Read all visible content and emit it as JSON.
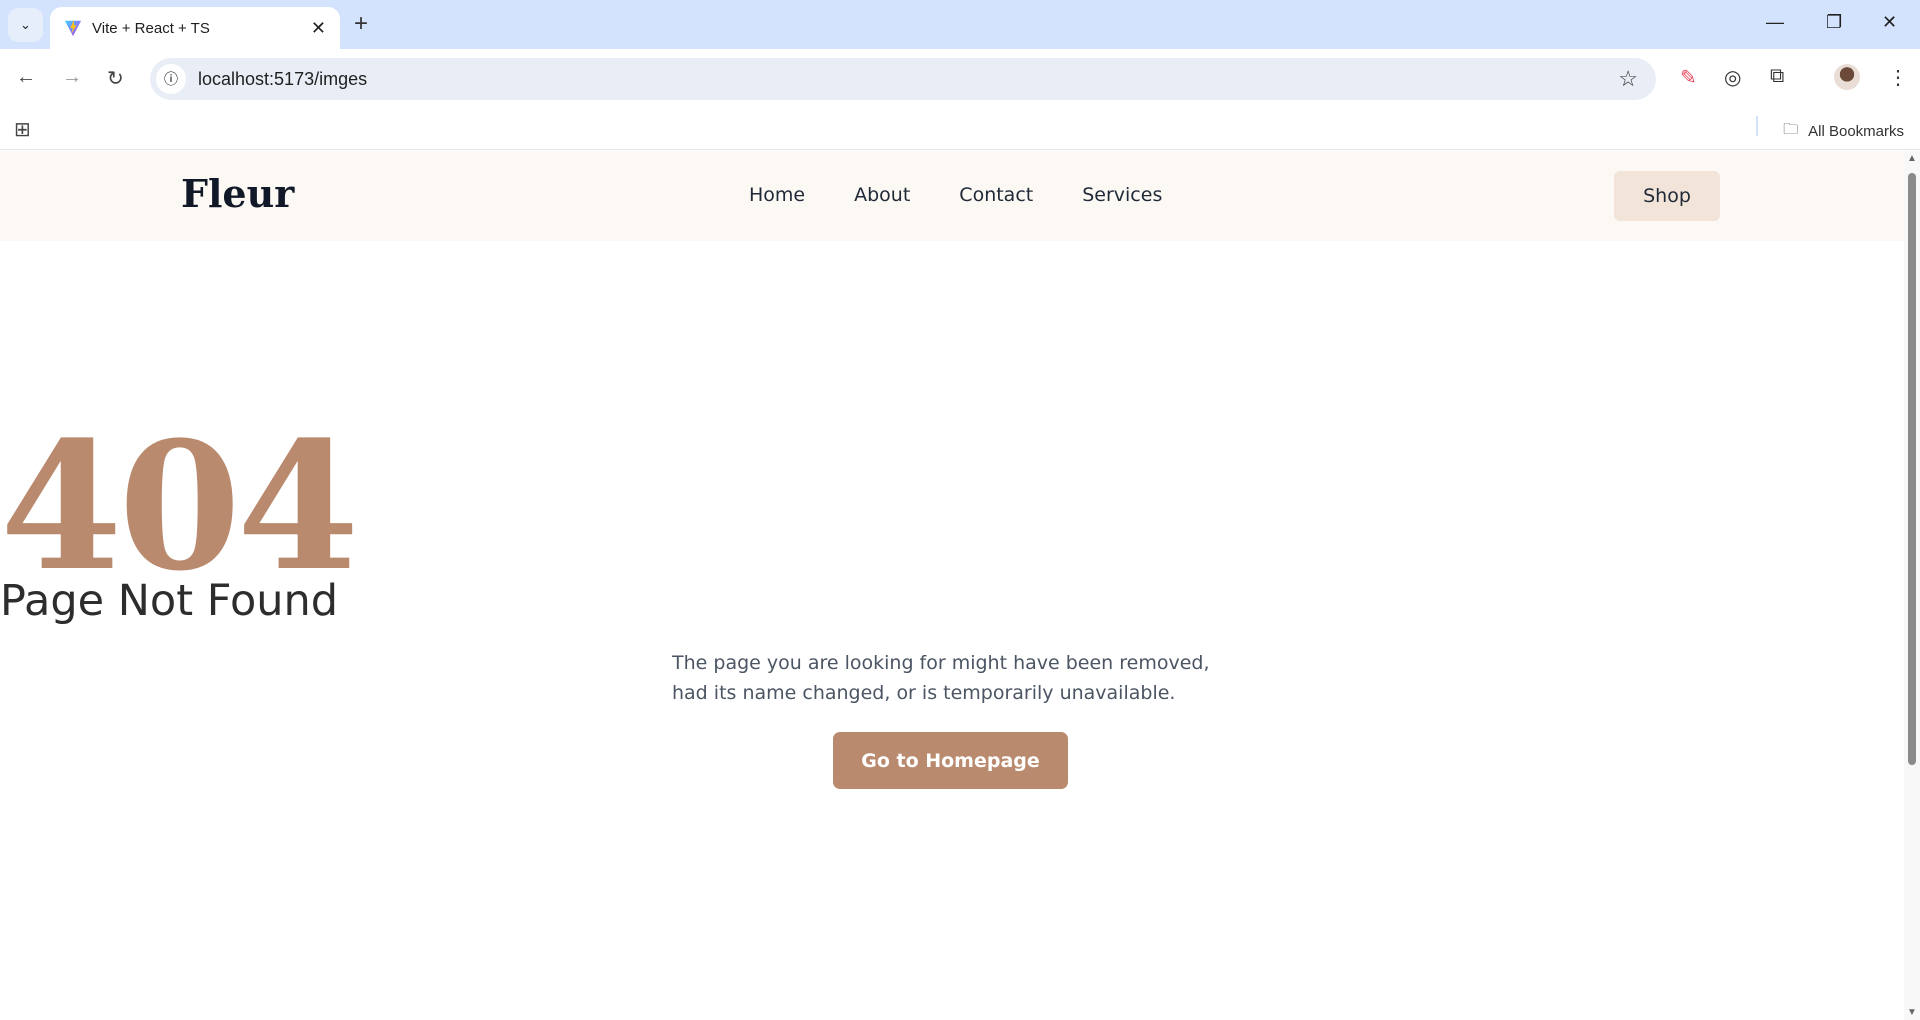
{
  "browser": {
    "tab_title": "Vite + React + TS",
    "url": "localhost:5173/imges",
    "bookmarks_label": "All Bookmarks",
    "icons": [
      "tab-search-icon",
      "vite-logo-icon",
      "close-icon",
      "plus-icon",
      "minimize-icon",
      "restore-icon",
      "window-close-icon",
      "back-icon",
      "forward-icon",
      "reload-icon",
      "info-icon",
      "star-icon",
      "eyedropper-extension-icon",
      "json-extension-icon",
      "extensions-puzzle-icon",
      "profile-avatar",
      "more-menu-icon",
      "apps-grid-icon",
      "folder-icon"
    ]
  },
  "site": {
    "logo": "Fleur",
    "nav": [
      {
        "label": "Home"
      },
      {
        "label": "About"
      },
      {
        "label": "Contact"
      },
      {
        "label": "Services"
      }
    ],
    "shop_label": "Shop"
  },
  "error": {
    "code": "404",
    "title": "Page Not Found",
    "message": "The page you are looking for might have been removed, had its name changed, or is temporarily unavailable.",
    "button_label": "Go to Homepage"
  },
  "colors": {
    "accent": "#b98a6e",
    "header_bg": "#fcf8f3",
    "shop_bg": "#f3e4da",
    "text": "#2d2d2d"
  }
}
